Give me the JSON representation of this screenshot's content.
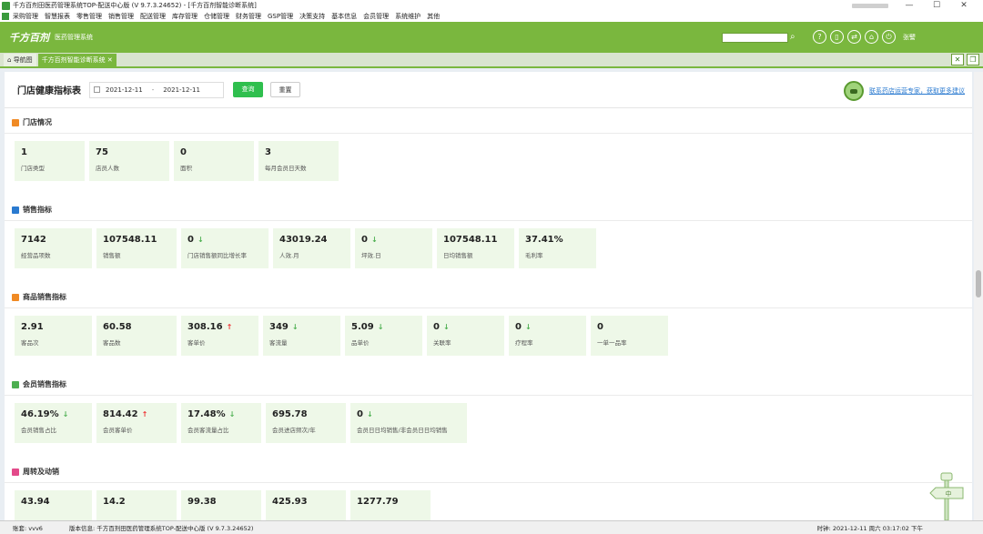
{
  "window": {
    "title": "千方百剂田医药管理系统TOP-配送中心版 (V 9.7.3.24652)  - [千方百剂智能诊断系统]"
  },
  "menu": [
    "采购管理",
    "智慧报表",
    "零售管理",
    "销售管理",
    "配送管理",
    "库存管理",
    "仓储管理",
    "财务管理",
    "GSP管理",
    "决策支持",
    "基本信息",
    "会员管理",
    "系统维护",
    "其他"
  ],
  "header": {
    "logo": "千方百剂",
    "subtitle": "医药管理系统",
    "username": "张譬"
  },
  "tabs": [
    {
      "label": "导航图"
    },
    {
      "label": "千方百剂智能诊断系统"
    }
  ],
  "toolbar": {
    "title": "门店健康指标表",
    "date_start": "2021-12-11",
    "date_sep": "-",
    "date_end": "2021-12-11",
    "query_label": "查询",
    "reset_label": "重置",
    "contact_link": "联系药店运营专家，获取更多建议"
  },
  "sections": [
    {
      "title": "门店情况",
      "color": "#f08a24",
      "cards": [
        {
          "value": "1",
          "label": "门店类型",
          "trend": ""
        },
        {
          "value": "75",
          "label": "店员人数",
          "trend": ""
        },
        {
          "value": "0",
          "label": "面积",
          "trend": ""
        },
        {
          "value": "3",
          "label": "每月会员日天数",
          "trend": ""
        }
      ]
    },
    {
      "title": "销售指标",
      "color": "#2a7ad0",
      "cards": [
        {
          "value": "7142",
          "label": "经营品项数",
          "trend": ""
        },
        {
          "value": "107548.11",
          "label": "销售额",
          "trend": ""
        },
        {
          "value": "0",
          "label": "门店销售额同比增长率",
          "trend": "down"
        },
        {
          "value": "43019.24",
          "label": "人效.月",
          "trend": ""
        },
        {
          "value": "0",
          "label": "坪效.日",
          "trend": "down"
        },
        {
          "value": "107548.11",
          "label": "日均销售额",
          "trend": ""
        },
        {
          "value": "37.41%",
          "label": "毛利率",
          "trend": ""
        }
      ]
    },
    {
      "title": "商品销售指标",
      "color": "#f08a24",
      "cards": [
        {
          "value": "2.91",
          "label": "客品次",
          "trend": ""
        },
        {
          "value": "60.58",
          "label": "客品数",
          "trend": ""
        },
        {
          "value": "308.16",
          "label": "客单价",
          "trend": "up"
        },
        {
          "value": "349",
          "label": "客流量",
          "trend": "down"
        },
        {
          "value": "5.09",
          "label": "品单价",
          "trend": "down"
        },
        {
          "value": "0",
          "label": "关联率",
          "trend": "down"
        },
        {
          "value": "0",
          "label": "疗程率",
          "trend": "down"
        },
        {
          "value": "0",
          "label": "一单一品率",
          "trend": ""
        }
      ]
    },
    {
      "title": "会员销售指标",
      "color": "#4caf50",
      "cards": [
        {
          "value": "46.19%",
          "label": "会员销售占比",
          "trend": "down"
        },
        {
          "value": "814.42",
          "label": "会员客单价",
          "trend": "up"
        },
        {
          "value": "17.48%",
          "label": "会员客流量占比",
          "trend": "down"
        },
        {
          "value": "695.78",
          "label": "会员进店频次/年",
          "trend": ""
        },
        {
          "value": "0",
          "label": "会员日日均销售/非会员日日均销售",
          "trend": "down"
        }
      ]
    },
    {
      "title": "周转及动销",
      "color": "#e34a8a",
      "cards": [
        {
          "value": "43.94",
          "label": "",
          "trend": ""
        },
        {
          "value": "14.2",
          "label": "",
          "trend": ""
        },
        {
          "value": "99.38",
          "label": "",
          "trend": ""
        },
        {
          "value": "425.93",
          "label": "",
          "trend": ""
        },
        {
          "value": "1277.79",
          "label": "",
          "trend": ""
        }
      ]
    }
  ],
  "statusbar": {
    "user": "账套: vvv6",
    "info": "版本信息: 千方百剂田医药管理系统TOP-配送中心版 (V 9.7.3.24652)",
    "time": "时钟: 2021-12-11  周六 03:17:02 下午"
  }
}
